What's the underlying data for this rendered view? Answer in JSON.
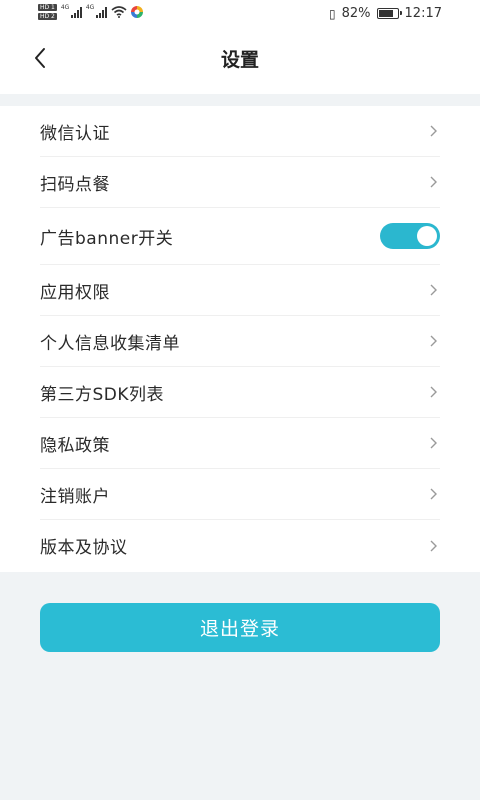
{
  "status_bar": {
    "hd1": "HD 1",
    "hd2": "HD 2",
    "net1": "4G",
    "net2": "4G",
    "battery_percent": "82%",
    "battery_level": 0.82,
    "time": "12:17"
  },
  "header": {
    "title": "设置"
  },
  "settings": {
    "items": [
      {
        "label": "微信认证"
      },
      {
        "label": "扫码点餐"
      },
      {
        "label": "广告banner开关",
        "toggle_on": true
      },
      {
        "label": "应用权限"
      },
      {
        "label": "个人信息收集清单"
      },
      {
        "label": "第三方SDK列表"
      },
      {
        "label": "隐私政策"
      },
      {
        "label": "注销账户"
      },
      {
        "label": "版本及协议"
      }
    ]
  },
  "logout": {
    "label": "退出登录"
  },
  "colors": {
    "accent": "#2bbcd4",
    "background": "#f0f3f5",
    "card": "#ffffff"
  }
}
